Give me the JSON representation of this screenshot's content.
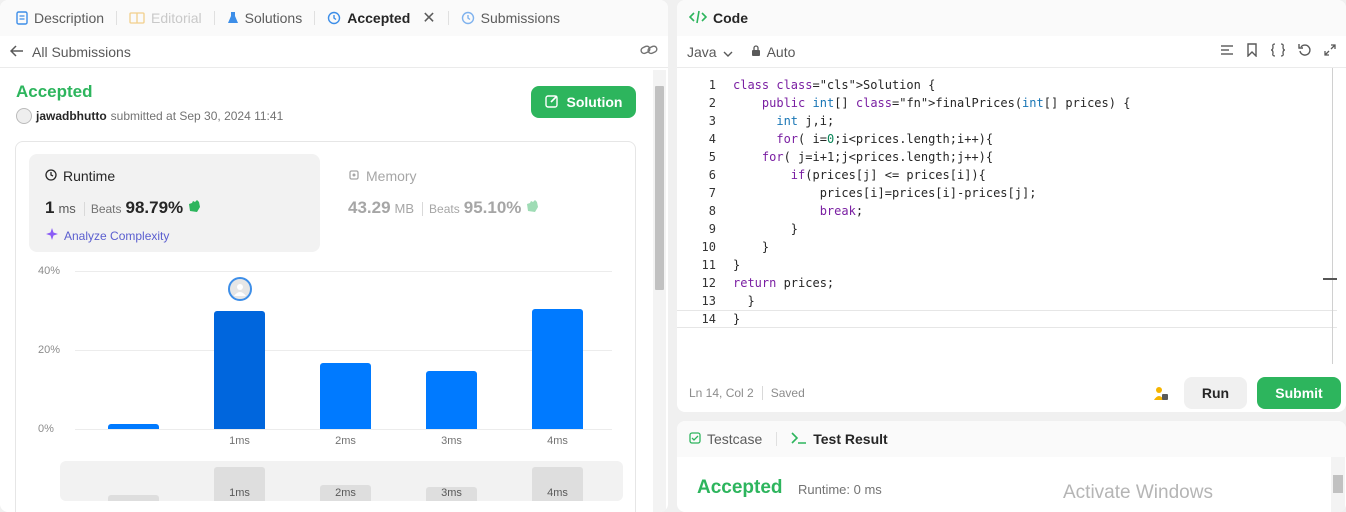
{
  "left_tabs": [
    {
      "label": "Description"
    },
    {
      "label": "Editorial"
    },
    {
      "label": "Solutions"
    },
    {
      "label": "Accepted"
    },
    {
      "label": "Submissions"
    }
  ],
  "subbar": {
    "back_label": "All Submissions"
  },
  "submission": {
    "status": "Accepted",
    "user": "jawadbhutto",
    "submitted_text": "submitted at Sep 30, 2024 11:41",
    "solution_button": "Solution"
  },
  "runtime": {
    "title": "Runtime",
    "value": "1",
    "unit": "ms",
    "beats_label": "Beats",
    "beats_pct": "98.79%",
    "analyze": "Analyze Complexity"
  },
  "memory": {
    "title": "Memory",
    "value": "43.29",
    "unit": "MB",
    "beats_label": "Beats",
    "beats_pct": "95.10%"
  },
  "chart_data": {
    "type": "bar",
    "categories": [
      "",
      "1ms",
      "2ms",
      "3ms",
      "4ms"
    ],
    "values": [
      1.2,
      29.8,
      16.6,
      14.8,
      30.5
    ],
    "y_ticks": [
      "40%",
      "20%",
      "0%"
    ],
    "ylim": [
      0,
      40
    ],
    "highlighted_index": 1,
    "mini_labels": [
      "",
      "1ms",
      "2ms",
      "3ms",
      "4ms"
    ],
    "mini_values": [
      0.15,
      0.85,
      0.4,
      0.35,
      0.85
    ]
  },
  "code_panel": {
    "title": "Code",
    "language": "Java",
    "mode": "Auto",
    "cursor": "Ln 14, Col 2",
    "saved": "Saved",
    "run": "Run",
    "submit": "Submit"
  },
  "code_lines": [
    "class Solution {",
    "    public int[] finalPrices(int[] prices) {",
    "      int j,i;",
    "      for( i=0;i<prices.length;i++){",
    "    for( j=i+1;j<prices.length;j++){",
    "        if(prices[j] <= prices[i]){",
    "            prices[i]=prices[i]-prices[j];",
    "            break;",
    "        }",
    "    }",
    "}",
    "return prices;",
    "  }",
    "}"
  ],
  "bottom": {
    "tabs": [
      {
        "label": "Testcase"
      },
      {
        "label": "Test Result"
      }
    ],
    "status": "Accepted",
    "runtime": "Runtime: 0 ms",
    "watermark": "Activate Windows"
  },
  "colors": {
    "accent_green": "#2db55d",
    "bar_blue": "#007aff"
  }
}
